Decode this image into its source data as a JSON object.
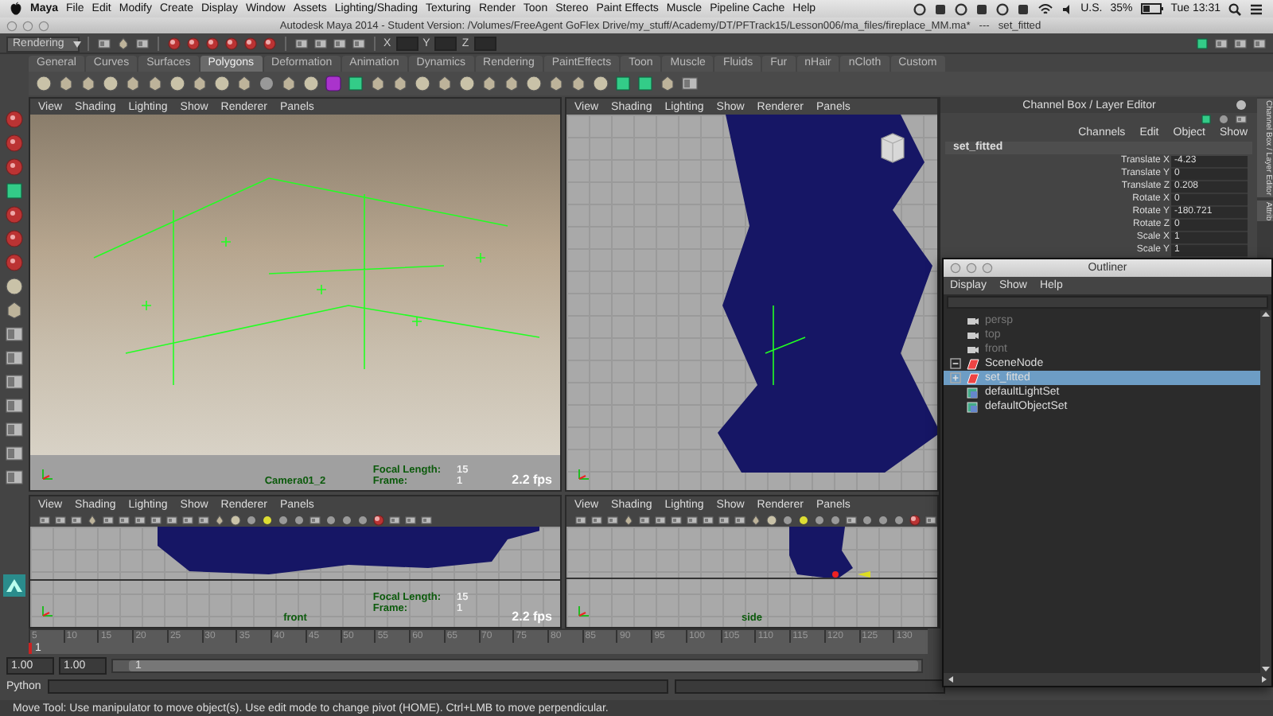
{
  "menu_bar": {
    "app": "Maya",
    "items": [
      "File",
      "Edit",
      "Modify",
      "Create",
      "Display",
      "Window",
      "Assets",
      "Lighting/Shading",
      "Texturing",
      "Render",
      "Toon",
      "Stereo",
      "Paint Effects",
      "Muscle",
      "Pipeline Cache",
      "Help"
    ],
    "input_source": "U.S.",
    "battery": "35%",
    "clock": "Tue 13:31"
  },
  "window": {
    "title": "Autodesk Maya 2014 - Student Version: /Volumes/FreeAgent GoFlex Drive/my_stuff/Academy/DT/PFTrack15/Lesson006/ma_files/fireplace_MM.ma*   ---   set_fitted"
  },
  "toolbar": {
    "mode": "Rendering",
    "fields": [
      {
        "label": "X"
      },
      {
        "label": "Y"
      },
      {
        "label": "Z"
      }
    ]
  },
  "shelf": {
    "tabs": [
      {
        "label": "General",
        "selected": false
      },
      {
        "label": "Curves",
        "selected": false
      },
      {
        "label": "Surfaces",
        "selected": false
      },
      {
        "label": "Polygons",
        "selected": true
      },
      {
        "label": "Deformation",
        "selected": false
      },
      {
        "label": "Animation",
        "selected": false
      },
      {
        "label": "Dynamics",
        "selected": false
      },
      {
        "label": "Rendering",
        "selected": false
      },
      {
        "label": "PaintEffects",
        "selected": false
      },
      {
        "label": "Toon",
        "selected": false
      },
      {
        "label": "Muscle",
        "selected": false
      },
      {
        "label": "Fluids",
        "selected": false
      },
      {
        "label": "Fur",
        "selected": false
      },
      {
        "label": "nHair",
        "selected": false
      },
      {
        "label": "nCloth",
        "selected": false
      },
      {
        "label": "Custom",
        "selected": false
      }
    ]
  },
  "viewports": [
    {
      "kind": "camera",
      "menu": [
        "View",
        "Shading",
        "Lighting",
        "Show",
        "Renderer",
        "Panels"
      ],
      "show_toolbar": false,
      "camera": "Camera01_2",
      "hud": [
        {
          "label": "Focal Length:",
          "value": "15"
        },
        {
          "label": "Frame:",
          "value": "1"
        }
      ],
      "fps": "2.2 fps"
    },
    {
      "kind": "perspective",
      "menu": [
        "View",
        "Shading",
        "Lighting",
        "Show",
        "Renderer",
        "Panels"
      ],
      "show_toolbar": false
    },
    {
      "kind": "front",
      "menu": [
        "View",
        "Shading",
        "Lighting",
        "Show",
        "Renderer",
        "Panels"
      ],
      "show_toolbar": true,
      "camera": "front",
      "hud": [
        {
          "label": "Focal Length:",
          "value": "15"
        },
        {
          "label": "Frame:",
          "value": "1"
        }
      ],
      "fps": "2.2 fps"
    },
    {
      "kind": "side",
      "menu": [
        "View",
        "Shading",
        "Lighting",
        "Show",
        "Renderer",
        "Panels"
      ],
      "show_toolbar": true,
      "camera": "side"
    }
  ],
  "channel_box": {
    "title": "Channel Box / Layer Editor",
    "menus": [
      "Channels",
      "Edit",
      "Object",
      "Show"
    ],
    "object": "set_fitted",
    "attributes": [
      {
        "name": "Translate X",
        "value": "-4.23"
      },
      {
        "name": "Translate Y",
        "value": "0"
      },
      {
        "name": "Translate Z",
        "value": "0.208"
      },
      {
        "name": "Rotate X",
        "value": "0"
      },
      {
        "name": "Rotate Y",
        "value": "-180.721"
      },
      {
        "name": "Rotate Z",
        "value": "0"
      },
      {
        "name": "Scale X",
        "value": "1"
      },
      {
        "name": "Scale Y",
        "value": "1"
      }
    ],
    "side_tabs": [
      "Channel Box / Layer Editor",
      "Attrib"
    ]
  },
  "outliner": {
    "title": "Outliner",
    "menus": [
      "Display",
      "Show",
      "Help"
    ],
    "items": [
      {
        "label": "persp",
        "kind": "camera",
        "dimmed": true,
        "selected": false
      },
      {
        "label": "top",
        "kind": "camera",
        "dimmed": true,
        "selected": false
      },
      {
        "label": "front",
        "kind": "camera",
        "dimmed": true,
        "selected": false
      },
      {
        "label": "SceneNode",
        "kind": "node",
        "dimmed": false,
        "selected": false,
        "expanded": true
      },
      {
        "label": "set_fitted",
        "kind": "node",
        "dimmed": false,
        "selected": true,
        "expanded": false
      },
      {
        "label": "defaultLightSet",
        "kind": "set",
        "dimmed": false,
        "selected": false
      },
      {
        "label": "defaultObjectSet",
        "kind": "set",
        "dimmed": false,
        "selected": false
      }
    ]
  },
  "timeline": {
    "level": 0,
    "ticks": [
      "5",
      "10",
      "15",
      "20",
      "25",
      "30",
      "35",
      "40",
      "45",
      "50",
      "55",
      "60",
      "65",
      "70",
      "75",
      "80",
      "85",
      "90",
      "95",
      "100",
      "105",
      "110",
      "115",
      "120",
      "125",
      "130"
    ],
    "current_frame": "1"
  },
  "range": {
    "level": 1,
    "start": "1.00",
    "playback_start": "1.00",
    "slider_label": "1"
  },
  "command_line": {
    "label": "Python"
  },
  "help_line": {
    "text": "Move Tool: Use manipulator to move object(s). Use edit mode to change pivot (HOME). Ctrl+LMB to move perpendicular."
  }
}
